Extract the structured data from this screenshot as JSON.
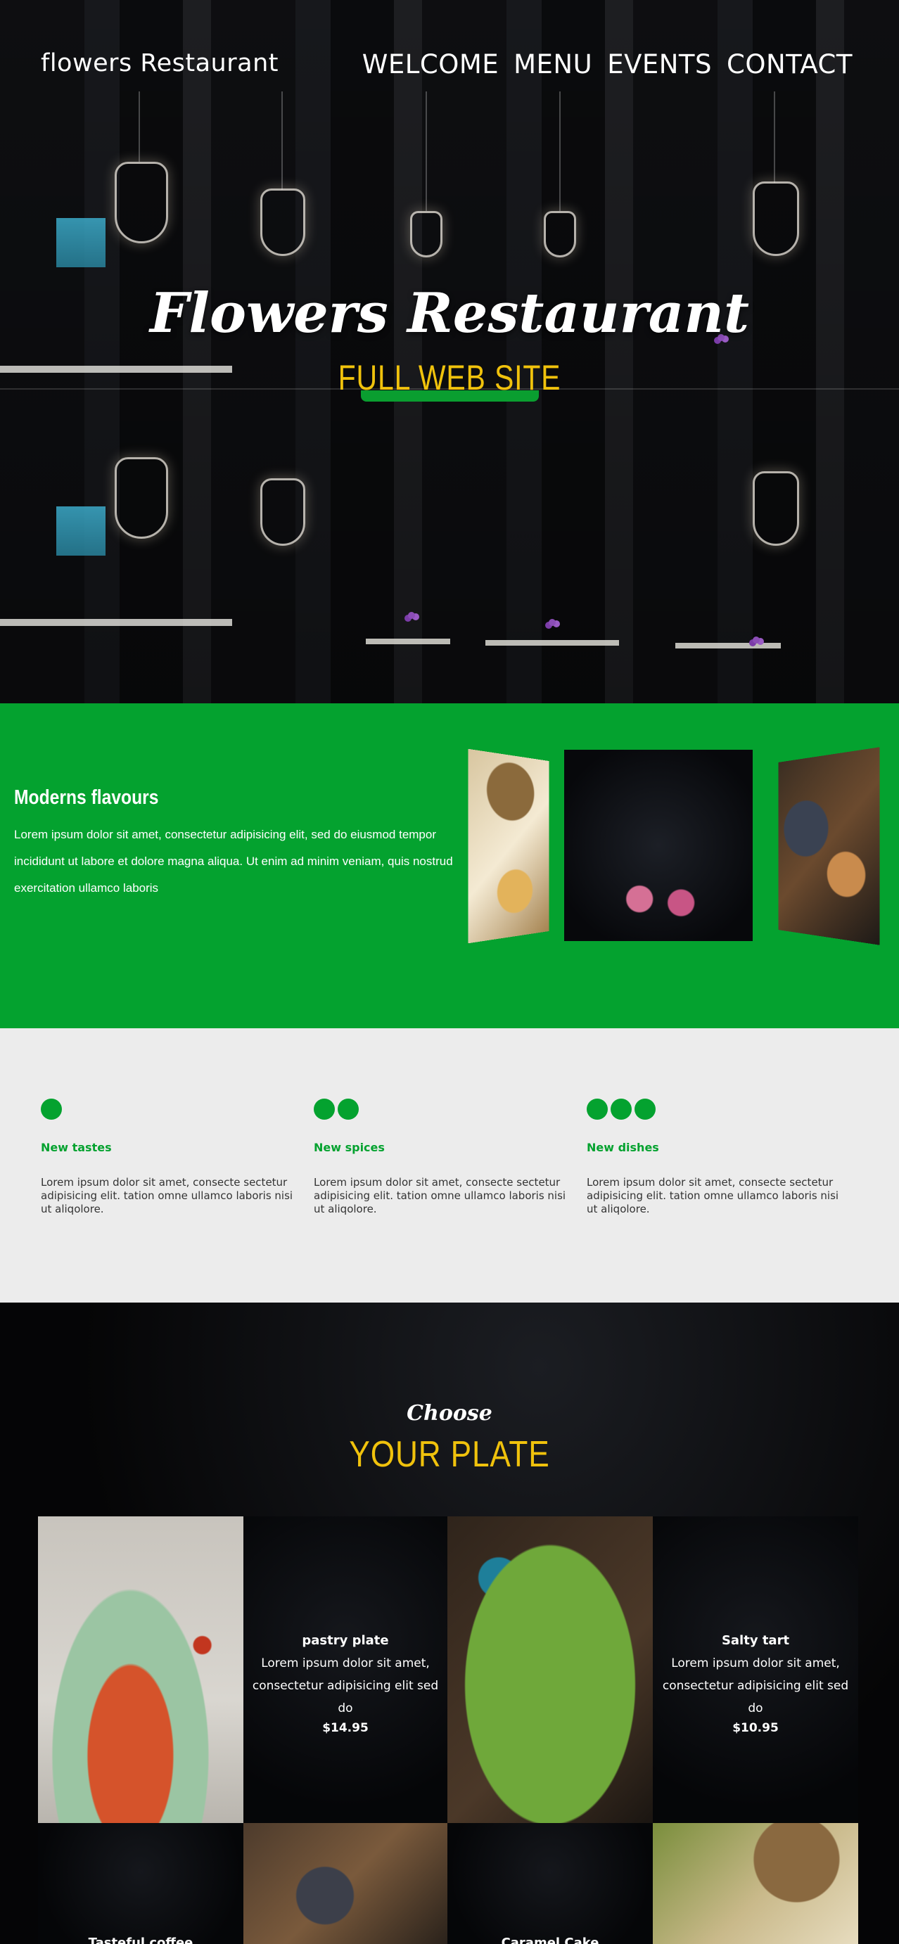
{
  "header": {
    "brand": "flowers Restaurant",
    "nav": [
      "WELCOME",
      "MENU",
      "EVENTS",
      "CONTACT"
    ]
  },
  "hero": {
    "title": "Flowers Restaurant",
    "subtitle": "FULL WEB SITE"
  },
  "flavours": {
    "title": "Moderns flavours",
    "text": "Lorem ipsum dolor sit amet, consectetur adipisicing elit, sed do eiusmod tempor incididunt ut labore et dolore magna aliqua. Ut enim ad minim veniam, quis nostrud exercitation ullamco laboris"
  },
  "features": [
    {
      "dots": 1,
      "title": "New tastes",
      "text": "Lorem ipsum dolor sit amet, consecte sectetur adipisicing elit. tation omne ullamco laboris nisi ut aliqolore."
    },
    {
      "dots": 2,
      "title": "New spices",
      "text": "Lorem ipsum dolor sit amet, consecte sectetur adipisicing elit. tation omne ullamco laboris nisi ut aliqolore."
    },
    {
      "dots": 3,
      "title": "New dishes",
      "text": "Lorem ipsum dolor sit amet, consecte sectetur adipisicing elit. tation omne ullamco laboris nisi ut aliqolore."
    }
  ],
  "plate": {
    "kicker": "Choose",
    "heading": "YOUR PLATE",
    "items": [
      {
        "name": "pastry plate",
        "desc": "Lorem ipsum dolor sit amet, consectetur adipisicing elit sed do",
        "price": "$14.95"
      },
      {
        "name": "Salty tart",
        "desc": "Lorem ipsum dolor sit amet, consectetur adipisicing elit sed do",
        "price": "$10.95"
      },
      {
        "name": "Tasteful coffee"
      },
      {
        "name": "Caramel Cake"
      }
    ]
  },
  "colors": {
    "brand_green": "#04a22f",
    "accent_yellow": "#f0c20c"
  }
}
